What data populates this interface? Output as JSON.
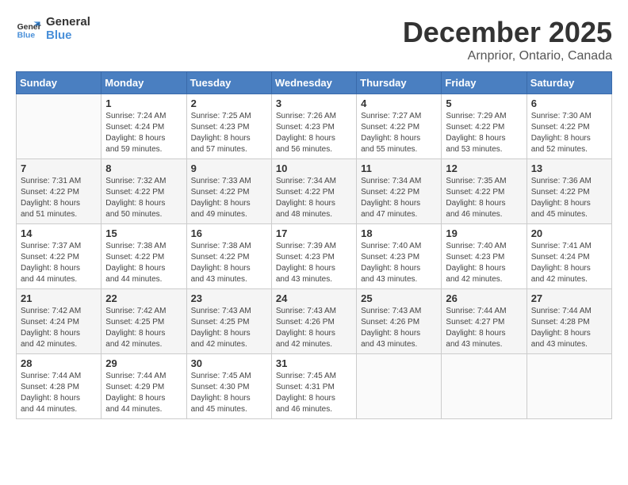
{
  "logo": {
    "line1": "General",
    "line2": "Blue"
  },
  "title": "December 2025",
  "location": "Arnprior, Ontario, Canada",
  "days_of_week": [
    "Sunday",
    "Monday",
    "Tuesday",
    "Wednesday",
    "Thursday",
    "Friday",
    "Saturday"
  ],
  "weeks": [
    [
      {
        "day": "",
        "info": ""
      },
      {
        "day": "1",
        "info": "Sunrise: 7:24 AM\nSunset: 4:24 PM\nDaylight: 8 hours\nand 59 minutes."
      },
      {
        "day": "2",
        "info": "Sunrise: 7:25 AM\nSunset: 4:23 PM\nDaylight: 8 hours\nand 57 minutes."
      },
      {
        "day": "3",
        "info": "Sunrise: 7:26 AM\nSunset: 4:23 PM\nDaylight: 8 hours\nand 56 minutes."
      },
      {
        "day": "4",
        "info": "Sunrise: 7:27 AM\nSunset: 4:22 PM\nDaylight: 8 hours\nand 55 minutes."
      },
      {
        "day": "5",
        "info": "Sunrise: 7:29 AM\nSunset: 4:22 PM\nDaylight: 8 hours\nand 53 minutes."
      },
      {
        "day": "6",
        "info": "Sunrise: 7:30 AM\nSunset: 4:22 PM\nDaylight: 8 hours\nand 52 minutes."
      }
    ],
    [
      {
        "day": "7",
        "info": "Sunrise: 7:31 AM\nSunset: 4:22 PM\nDaylight: 8 hours\nand 51 minutes."
      },
      {
        "day": "8",
        "info": "Sunrise: 7:32 AM\nSunset: 4:22 PM\nDaylight: 8 hours\nand 50 minutes."
      },
      {
        "day": "9",
        "info": "Sunrise: 7:33 AM\nSunset: 4:22 PM\nDaylight: 8 hours\nand 49 minutes."
      },
      {
        "day": "10",
        "info": "Sunrise: 7:34 AM\nSunset: 4:22 PM\nDaylight: 8 hours\nand 48 minutes."
      },
      {
        "day": "11",
        "info": "Sunrise: 7:34 AM\nSunset: 4:22 PM\nDaylight: 8 hours\nand 47 minutes."
      },
      {
        "day": "12",
        "info": "Sunrise: 7:35 AM\nSunset: 4:22 PM\nDaylight: 8 hours\nand 46 minutes."
      },
      {
        "day": "13",
        "info": "Sunrise: 7:36 AM\nSunset: 4:22 PM\nDaylight: 8 hours\nand 45 minutes."
      }
    ],
    [
      {
        "day": "14",
        "info": "Sunrise: 7:37 AM\nSunset: 4:22 PM\nDaylight: 8 hours\nand 44 minutes."
      },
      {
        "day": "15",
        "info": "Sunrise: 7:38 AM\nSunset: 4:22 PM\nDaylight: 8 hours\nand 44 minutes."
      },
      {
        "day": "16",
        "info": "Sunrise: 7:38 AM\nSunset: 4:22 PM\nDaylight: 8 hours\nand 43 minutes."
      },
      {
        "day": "17",
        "info": "Sunrise: 7:39 AM\nSunset: 4:23 PM\nDaylight: 8 hours\nand 43 minutes."
      },
      {
        "day": "18",
        "info": "Sunrise: 7:40 AM\nSunset: 4:23 PM\nDaylight: 8 hours\nand 43 minutes."
      },
      {
        "day": "19",
        "info": "Sunrise: 7:40 AM\nSunset: 4:23 PM\nDaylight: 8 hours\nand 42 minutes."
      },
      {
        "day": "20",
        "info": "Sunrise: 7:41 AM\nSunset: 4:24 PM\nDaylight: 8 hours\nand 42 minutes."
      }
    ],
    [
      {
        "day": "21",
        "info": "Sunrise: 7:42 AM\nSunset: 4:24 PM\nDaylight: 8 hours\nand 42 minutes."
      },
      {
        "day": "22",
        "info": "Sunrise: 7:42 AM\nSunset: 4:25 PM\nDaylight: 8 hours\nand 42 minutes."
      },
      {
        "day": "23",
        "info": "Sunrise: 7:43 AM\nSunset: 4:25 PM\nDaylight: 8 hours\nand 42 minutes."
      },
      {
        "day": "24",
        "info": "Sunrise: 7:43 AM\nSunset: 4:26 PM\nDaylight: 8 hours\nand 42 minutes."
      },
      {
        "day": "25",
        "info": "Sunrise: 7:43 AM\nSunset: 4:26 PM\nDaylight: 8 hours\nand 43 minutes."
      },
      {
        "day": "26",
        "info": "Sunrise: 7:44 AM\nSunset: 4:27 PM\nDaylight: 8 hours\nand 43 minutes."
      },
      {
        "day": "27",
        "info": "Sunrise: 7:44 AM\nSunset: 4:28 PM\nDaylight: 8 hours\nand 43 minutes."
      }
    ],
    [
      {
        "day": "28",
        "info": "Sunrise: 7:44 AM\nSunset: 4:28 PM\nDaylight: 8 hours\nand 44 minutes."
      },
      {
        "day": "29",
        "info": "Sunrise: 7:44 AM\nSunset: 4:29 PM\nDaylight: 8 hours\nand 44 minutes."
      },
      {
        "day": "30",
        "info": "Sunrise: 7:45 AM\nSunset: 4:30 PM\nDaylight: 8 hours\nand 45 minutes."
      },
      {
        "day": "31",
        "info": "Sunrise: 7:45 AM\nSunset: 4:31 PM\nDaylight: 8 hours\nand 46 minutes."
      },
      {
        "day": "",
        "info": ""
      },
      {
        "day": "",
        "info": ""
      },
      {
        "day": "",
        "info": ""
      }
    ]
  ]
}
